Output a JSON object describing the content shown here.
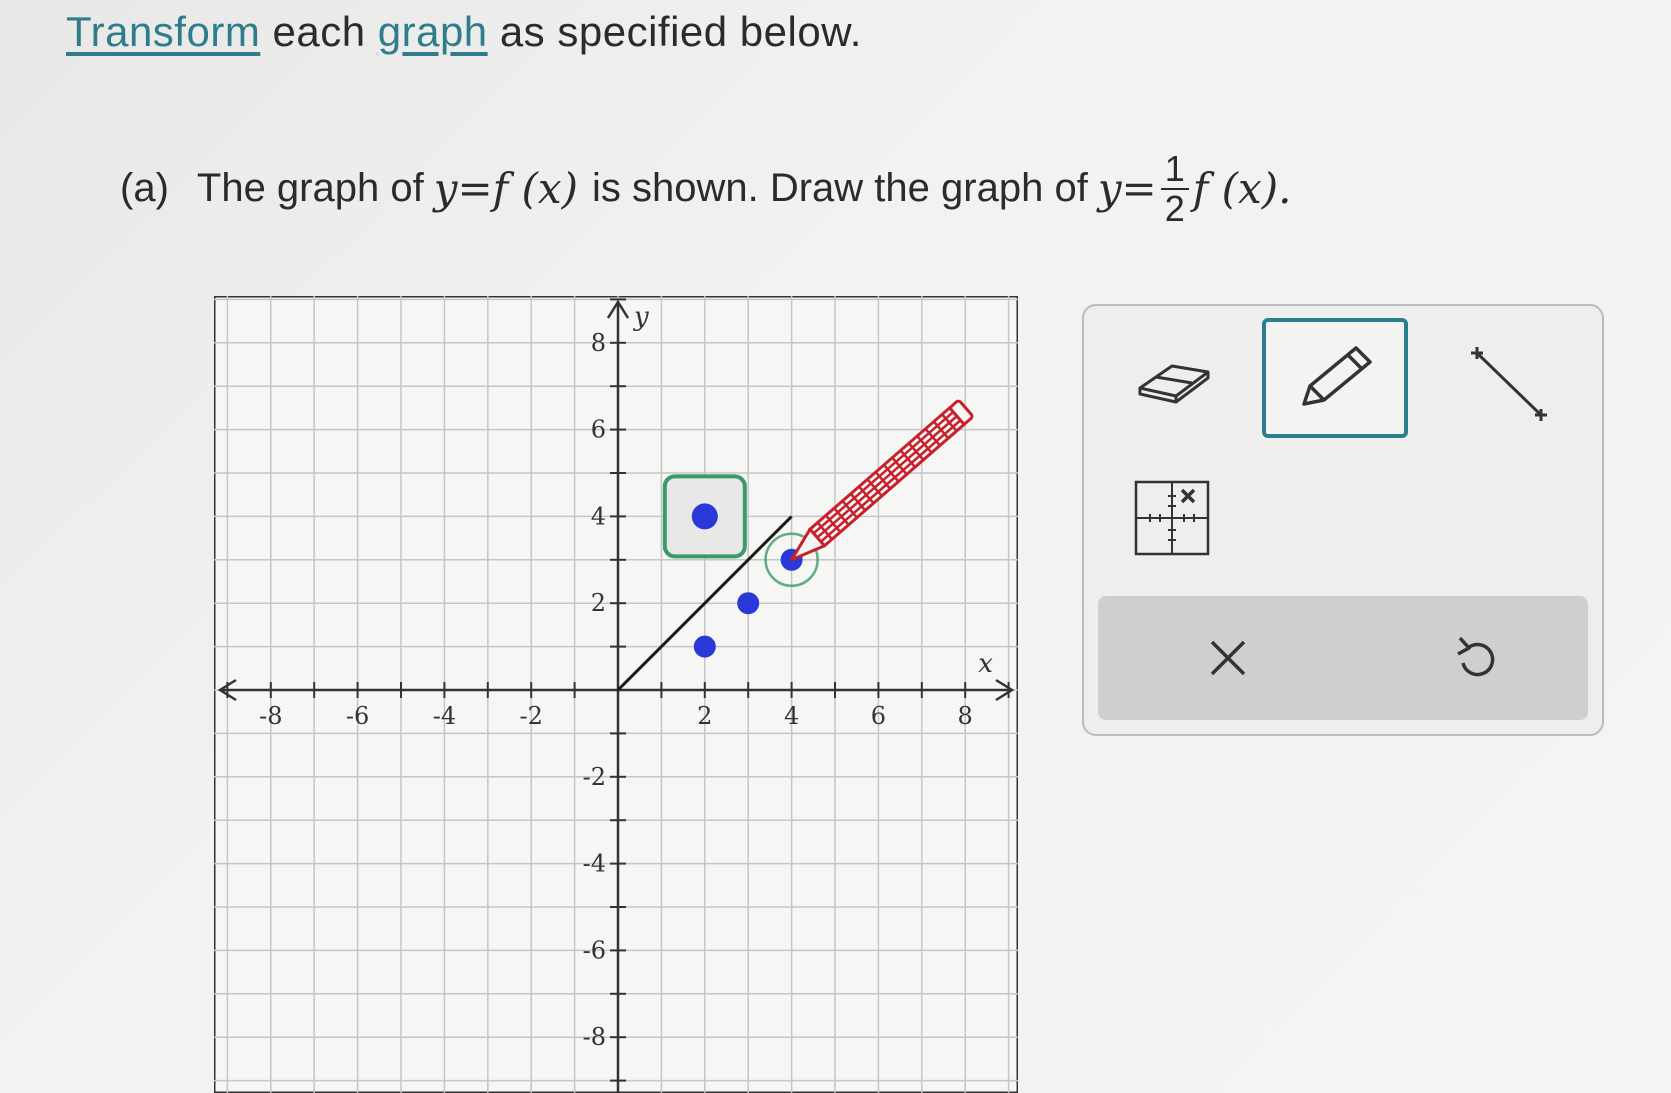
{
  "instructions": {
    "link1": "Transform",
    "middle": " each ",
    "link2": "graph",
    "end": " as specified below."
  },
  "question": {
    "label": "(a)",
    "text1": "The graph of",
    "eq1": "y=f (x)",
    "text2": "is shown. Draw the graph of",
    "eq2_left": "y=",
    "frac_num": "1",
    "frac_den": "2",
    "eq2_right": "f (x)."
  },
  "chart_data": {
    "type": "scatter",
    "xlim": [
      -9,
      9
    ],
    "ylim": [
      -9,
      9
    ],
    "xlabel": "x",
    "ylabel": "y",
    "grid": true,
    "x_tick_labels": [
      "-8",
      "-6",
      "-4",
      "-2",
      "2",
      "4",
      "6",
      "8"
    ],
    "y_tick_labels": [
      "8",
      "6",
      "4",
      "2",
      "-2",
      "-4",
      "-6",
      "-8"
    ],
    "line_segment": {
      "points": [
        [
          0,
          0
        ],
        [
          4,
          4
        ]
      ],
      "color": "#1a1a1a"
    },
    "plotted_points": [
      {
        "x": 2,
        "y": 1
      },
      {
        "x": 3,
        "y": 2
      },
      {
        "x": 4,
        "y": 3
      }
    ],
    "highlighted_point": {
      "x": 2,
      "y": 4
    },
    "point_color": "#2a38d8",
    "highlight_box_color": "#3a9a6a",
    "cursor_color": "#c8202a"
  },
  "toolbar": {
    "eraser_icon": "eraser-icon",
    "pencil_icon": "pencil-icon",
    "line_icon": "line-segment-icon",
    "point_icon": "point-grid-icon",
    "clear_icon": "close-icon",
    "undo_icon": "undo-icon",
    "selected_tool": "pencil",
    "accent": "#2a7f8f"
  }
}
